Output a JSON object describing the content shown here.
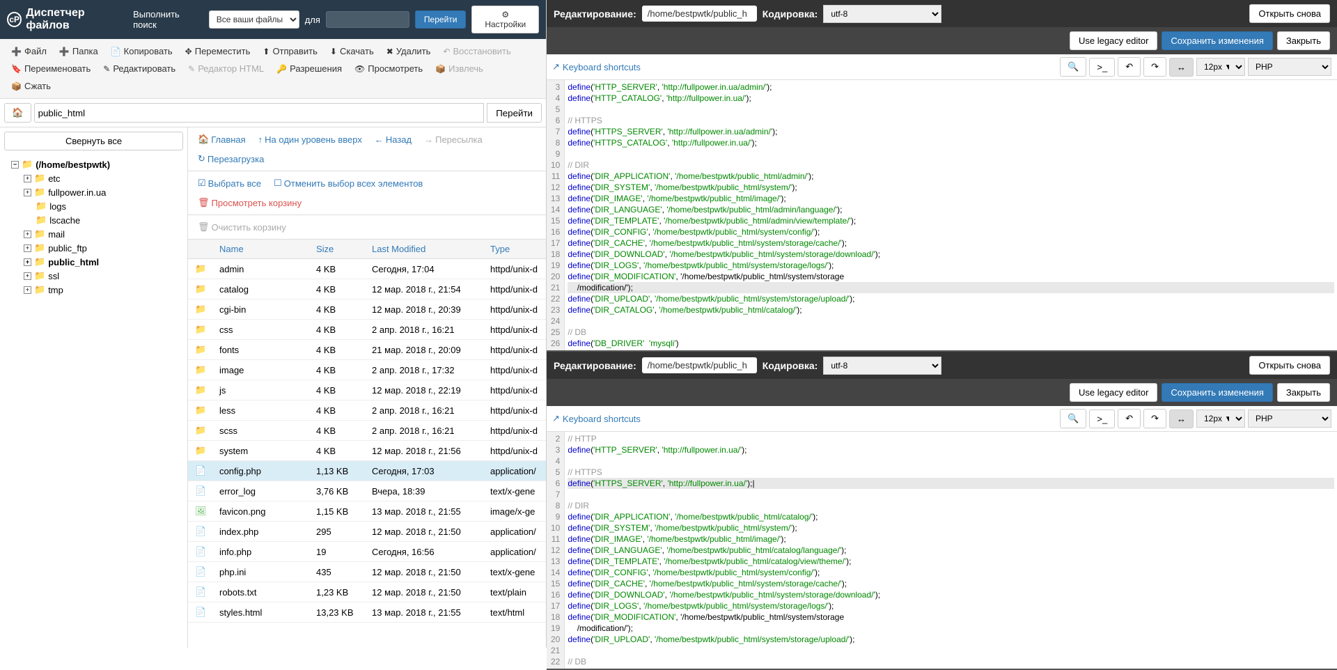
{
  "fm": {
    "title": "Диспетчер файлов",
    "search_label": "Выполнить поиск",
    "search_scope": "Все ваши файлы",
    "for_label": "для",
    "go": "Перейти",
    "settings": "Настройки"
  },
  "toolbar": {
    "file": "Файл",
    "folder": "Папка",
    "copy": "Копировать",
    "move": "Переместить",
    "send": "Отправить",
    "download": "Скачать",
    "delete": "Удалить",
    "restore": "Восстановить",
    "rename": "Переименовать",
    "edit": "Редактировать",
    "htmleditor": "Редактор HTML",
    "perms": "Разрешения",
    "view": "Просмотреть",
    "extract": "Извлечь",
    "compress": "Сжать"
  },
  "path": {
    "value": "public_html",
    "go": "Перейти"
  },
  "tree": {
    "collapse": "Свернуть все",
    "root": "(/home/bestpwtk)",
    "items": [
      "etc",
      "fullpower.in.ua",
      "logs",
      "lscache",
      "mail",
      "public_ftp",
      "public_html",
      "ssl",
      "tmp"
    ]
  },
  "listbar": {
    "home": "Главная",
    "up": "На один уровень вверх",
    "back": "Назад",
    "forward": "Пересылка",
    "reload": "Перезагрузка",
    "selectall": "Выбрать все",
    "deselect": "Отменить выбор всех элементов",
    "trash": "Просмотреть корзину",
    "emptytrash": "Очистить корзину"
  },
  "cols": {
    "name": "Name",
    "size": "Size",
    "modified": "Last Modified",
    "type": "Type"
  },
  "files": [
    {
      "icon": "folder",
      "name": "admin",
      "size": "4 KB",
      "mod": "Сегодня, 17:04",
      "type": "httpd/unix-d"
    },
    {
      "icon": "folder",
      "name": "catalog",
      "size": "4 KB",
      "mod": "12 мар. 2018 г., 21:54",
      "type": "httpd/unix-d"
    },
    {
      "icon": "folder",
      "name": "cgi-bin",
      "size": "4 KB",
      "mod": "12 мар. 2018 г., 20:39",
      "type": "httpd/unix-d"
    },
    {
      "icon": "folder",
      "name": "css",
      "size": "4 KB",
      "mod": "2 апр. 2018 г., 16:21",
      "type": "httpd/unix-d"
    },
    {
      "icon": "folder",
      "name": "fonts",
      "size": "4 KB",
      "mod": "21 мар. 2018 г., 20:09",
      "type": "httpd/unix-d"
    },
    {
      "icon": "folder",
      "name": "image",
      "size": "4 KB",
      "mod": "2 апр. 2018 г., 17:32",
      "type": "httpd/unix-d"
    },
    {
      "icon": "folder",
      "name": "js",
      "size": "4 KB",
      "mod": "12 мар. 2018 г., 22:19",
      "type": "httpd/unix-d"
    },
    {
      "icon": "folder",
      "name": "less",
      "size": "4 KB",
      "mod": "2 апр. 2018 г., 16:21",
      "type": "httpd/unix-d"
    },
    {
      "icon": "folder",
      "name": "scss",
      "size": "4 KB",
      "mod": "2 апр. 2018 г., 16:21",
      "type": "httpd/unix-d"
    },
    {
      "icon": "folder",
      "name": "system",
      "size": "4 KB",
      "mod": "12 мар. 2018 г., 21:56",
      "type": "httpd/unix-d"
    },
    {
      "icon": "doc",
      "name": "config.php",
      "size": "1,13 KB",
      "mod": "Сегодня, 17:03",
      "type": "application/",
      "selected": true
    },
    {
      "icon": "doc",
      "name": "error_log",
      "size": "3,76 KB",
      "mod": "Вчера, 18:39",
      "type": "text/x-gene"
    },
    {
      "icon": "img",
      "name": "favicon.png",
      "size": "1,15 KB",
      "mod": "13 мар. 2018 г., 21:55",
      "type": "image/x-ge"
    },
    {
      "icon": "doc",
      "name": "index.php",
      "size": "295",
      "mod": "12 мар. 2018 г., 21:50",
      "type": "application/"
    },
    {
      "icon": "doc",
      "name": "info.php",
      "size": "19",
      "mod": "Сегодня, 16:56",
      "type": "application/"
    },
    {
      "icon": "doc",
      "name": "php.ini",
      "size": "435",
      "mod": "12 мар. 2018 г., 21:50",
      "type": "text/x-gene"
    },
    {
      "icon": "doc",
      "name": "robots.txt",
      "size": "1,23 KB",
      "mod": "12 мар. 2018 г., 21:50",
      "type": "text/plain"
    },
    {
      "icon": "doc",
      "name": "styles.html",
      "size": "13,23 KB",
      "mod": "13 мар. 2018 г., 21:55",
      "type": "text/html"
    }
  ],
  "editor": {
    "editing": "Редактирование:",
    "encoding": "Кодировка:",
    "reopen": "Открыть снова",
    "legacy": "Use legacy editor",
    "save": "Сохранить изменения",
    "close": "Закрыть",
    "shortcuts": "Keyboard shortcuts",
    "path": "/home/bestpwtk/public_h",
    "enc": "utf-8",
    "fontsize": "12px ▼",
    "lang": "PHP"
  },
  "code1": {
    "start": 3,
    "hl": 21,
    "lines": [
      "define('HTTP_SERVER', 'http://fullpower.in.ua/admin/');",
      "define('HTTP_CATALOG', 'http://fullpower.in.ua/');",
      "",
      "// HTTPS",
      "define('HTTPS_SERVER', 'http://fullpower.in.ua/admin/');",
      "define('HTTPS_CATALOG', 'http://fullpower.in.ua/');",
      "",
      "// DIR",
      "define('DIR_APPLICATION', '/home/bestpwtk/public_html/admin/');",
      "define('DIR_SYSTEM', '/home/bestpwtk/public_html/system/');",
      "define('DIR_IMAGE', '/home/bestpwtk/public_html/image/');",
      "define('DIR_LANGUAGE', '/home/bestpwtk/public_html/admin/language/');",
      "define('DIR_TEMPLATE', '/home/bestpwtk/public_html/admin/view/template/');",
      "define('DIR_CONFIG', '/home/bestpwtk/public_html/system/config/');",
      "define('DIR_CACHE', '/home/bestpwtk/public_html/system/storage/cache/');",
      "define('DIR_DOWNLOAD', '/home/bestpwtk/public_html/system/storage/download/');",
      "define('DIR_LOGS', '/home/bestpwtk/public_html/system/storage/logs/');",
      "define('DIR_MODIFICATION', '/home/bestpwtk/public_html/system/storage",
      "    /modification/');",
      "define('DIR_UPLOAD', '/home/bestpwtk/public_html/system/storage/upload/');",
      "define('DIR_CATALOG', '/home/bestpwtk/public_html/catalog/');",
      "",
      "// DB",
      "define('DB_DRIVER'  'mysqli')"
    ]
  },
  "code2": {
    "start": 2,
    "hl": 6,
    "lines": [
      "// HTTP",
      "define('HTTP_SERVER', 'http://fullpower.in.ua/');",
      "",
      "// HTTPS",
      "define('HTTPS_SERVER', 'http://fullpower.in.ua/');|",
      "",
      "// DIR",
      "define('DIR_APPLICATION', '/home/bestpwtk/public_html/catalog/');",
      "define('DIR_SYSTEM', '/home/bestpwtk/public_html/system/');",
      "define('DIR_IMAGE', '/home/bestpwtk/public_html/image/');",
      "define('DIR_LANGUAGE', '/home/bestpwtk/public_html/catalog/language/');",
      "define('DIR_TEMPLATE', '/home/bestpwtk/public_html/catalog/view/theme/');",
      "define('DIR_CONFIG', '/home/bestpwtk/public_html/system/config/');",
      "define('DIR_CACHE', '/home/bestpwtk/public_html/system/storage/cache/');",
      "define('DIR_DOWNLOAD', '/home/bestpwtk/public_html/system/storage/download/');",
      "define('DIR_LOGS', '/home/bestpwtk/public_html/system/storage/logs/');",
      "define('DIR_MODIFICATION', '/home/bestpwtk/public_html/system/storage",
      "    /modification/');",
      "define('DIR_UPLOAD', '/home/bestpwtk/public_html/system/storage/upload/');",
      "",
      "// DB"
    ]
  }
}
